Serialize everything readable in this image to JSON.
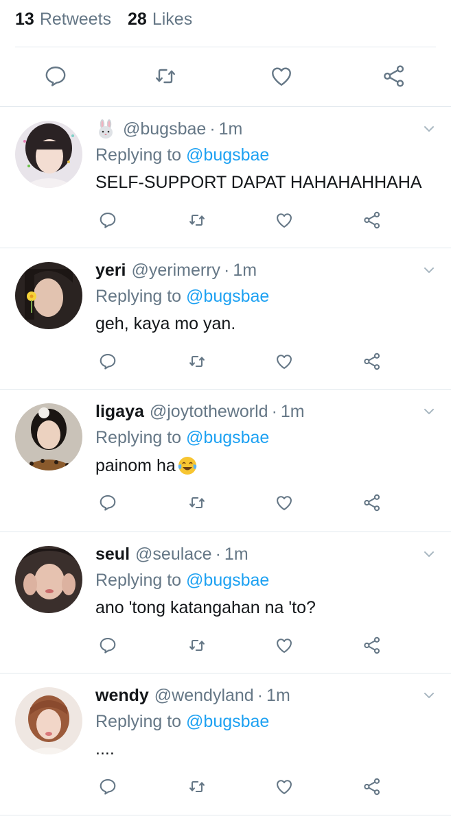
{
  "stats": {
    "retweets_count": "13",
    "retweets_label": "Retweets",
    "likes_count": "28",
    "likes_label": "Likes"
  },
  "icons": {
    "reply": "reply-icon",
    "retweet": "retweet-icon",
    "like": "heart-icon",
    "share": "share-icon",
    "caret": "chevron-down-icon"
  },
  "colors": {
    "icon_gray": "#657786",
    "link_blue": "#1da1f2",
    "divider": "#e1e8ed"
  },
  "replies": [
    {
      "name": "",
      "name_emoji": "rabbit-emoji",
      "handle": "@bugsbae",
      "dot": "·",
      "time": "1m",
      "replying_prefix": "Replying to",
      "replying_to": "@bugsbae",
      "text": "SELF-SUPPORT DAPAT HAHAHAHHAHA"
    },
    {
      "name": "yeri",
      "handle": "@yerimerry",
      "dot": "·",
      "time": "1m",
      "replying_prefix": "Replying to",
      "replying_to": "@bugsbae",
      "text": "geh, kaya mo yan."
    },
    {
      "name": "ligaya",
      "handle": "@joytotheworld",
      "dot": "·",
      "time": "1m",
      "replying_prefix": "Replying to",
      "replying_to": "@bugsbae",
      "text": "painom ha",
      "text_emoji": "tears-of-joy-emoji"
    },
    {
      "name": "seul",
      "handle": "@seulace",
      "dot": "·",
      "time": "1m",
      "replying_prefix": "Replying to",
      "replying_to": "@bugsbae",
      "text": "ano 'tong katangahan na 'to?"
    },
    {
      "name": "wendy",
      "handle": "@wendyland",
      "dot": "·",
      "time": "1m",
      "replying_prefix": "Replying to",
      "replying_to": "@bugsbae",
      "text": "...."
    }
  ]
}
